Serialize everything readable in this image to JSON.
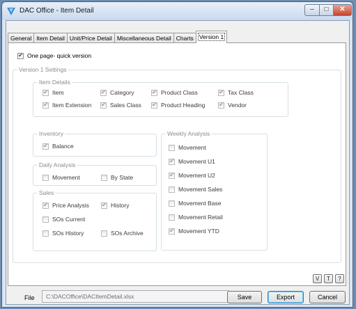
{
  "window": {
    "title": "DAC Office - Item Detail"
  },
  "tabs": [
    {
      "label": "General"
    },
    {
      "label": "Item Detail"
    },
    {
      "label": "Unit/Price Detail"
    },
    {
      "label": "Miscellaneous Detail"
    },
    {
      "label": "Charts"
    },
    {
      "label": "Version 1"
    }
  ],
  "one_page": {
    "label": "One page- quick version",
    "checked": true
  },
  "version_settings": {
    "label": "Version 1 Settings"
  },
  "item_details": {
    "label": "Item Details",
    "items": [
      {
        "label": "Item",
        "checked": true
      },
      {
        "label": "Category",
        "checked": true
      },
      {
        "label": "Product Class",
        "checked": true
      },
      {
        "label": "Tax Class",
        "checked": true
      },
      {
        "label": "Item Extension",
        "checked": true
      },
      {
        "label": "Sales Class",
        "checked": true
      },
      {
        "label": "Product Heading",
        "checked": true
      },
      {
        "label": "Vendor",
        "checked": true
      }
    ]
  },
  "inventory": {
    "label": "Inventory",
    "items": [
      {
        "label": "Balance",
        "checked": true
      }
    ]
  },
  "daily_analysis": {
    "label": "Daily Analysis",
    "items": [
      {
        "label": "Movement",
        "checked": false
      },
      {
        "label": "By State",
        "checked": false
      }
    ]
  },
  "sales": {
    "label": "Sales",
    "items": [
      {
        "label": "Price Analysis",
        "checked": true
      },
      {
        "label": "History",
        "checked": true
      },
      {
        "label": "SOs Current",
        "checked": false
      },
      {
        "label": "SOs History",
        "checked": false
      },
      {
        "label": "SOs Archive",
        "checked": false
      }
    ]
  },
  "weekly_analysis": {
    "label": "Weekly Analysis",
    "items": [
      {
        "label": "Movement",
        "checked": false
      },
      {
        "label": "Movement U1",
        "checked": true
      },
      {
        "label": "Movement U2",
        "checked": true
      },
      {
        "label": "Movement Sales",
        "checked": false
      },
      {
        "label": "Movement Base",
        "checked": false
      },
      {
        "label": "Movement Retail",
        "checked": false
      },
      {
        "label": "Movement YTD",
        "checked": true
      }
    ]
  },
  "tools": {
    "v": "V",
    "t": "T",
    "help": "?"
  },
  "file": {
    "label": "File",
    "value": "C:\\DACOffice\\DACItemDetail.xlsx"
  },
  "buttons": {
    "save": "Save",
    "export": "Export",
    "cancel": "Cancel"
  }
}
